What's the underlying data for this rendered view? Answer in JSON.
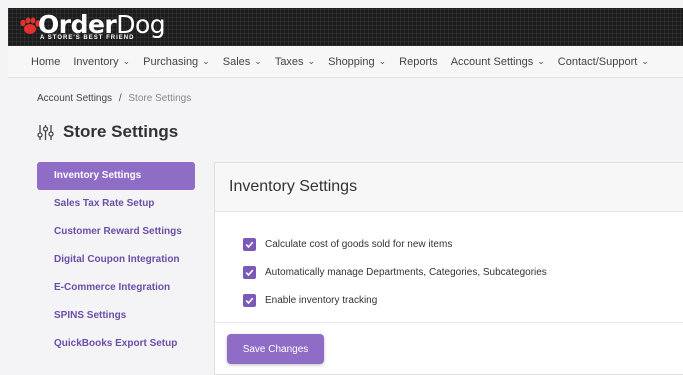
{
  "logo": {
    "name_bold": "Order",
    "name_light": "Dog",
    "tagline": "A STORE'S BEST FRIEND",
    "icon": "paw-icon",
    "accent": "#e3322b"
  },
  "nav": {
    "items": [
      {
        "label": "Home",
        "dropdown": false
      },
      {
        "label": "Inventory",
        "dropdown": true
      },
      {
        "label": "Purchasing",
        "dropdown": true
      },
      {
        "label": "Sales",
        "dropdown": true
      },
      {
        "label": "Taxes",
        "dropdown": true
      },
      {
        "label": "Shopping",
        "dropdown": true
      },
      {
        "label": "Reports",
        "dropdown": false
      },
      {
        "label": "Account Settings",
        "dropdown": true
      },
      {
        "label": "Contact/Support",
        "dropdown": true
      }
    ],
    "chevron": "⌄"
  },
  "breadcrumb": {
    "parent": "Account Settings",
    "separator": "/",
    "current": "Store Settings"
  },
  "page": {
    "title": "Store Settings",
    "icon": "sliders-icon"
  },
  "sidebar": {
    "items": [
      {
        "label": "Inventory Settings",
        "active": true
      },
      {
        "label": "Sales Tax Rate Setup",
        "active": false
      },
      {
        "label": "Customer Reward Settings",
        "active": false
      },
      {
        "label": "Digital Coupon Integration",
        "active": false
      },
      {
        "label": "E-Commerce Integration",
        "active": false
      },
      {
        "label": "SPINS Settings",
        "active": false
      },
      {
        "label": "QuickBooks Export Setup",
        "active": false
      }
    ]
  },
  "panel": {
    "title": "Inventory Settings",
    "options": [
      {
        "label": "Calculate cost of goods sold for new items",
        "checked": true
      },
      {
        "label": "Automatically manage Departments, Categories, Subcategories",
        "checked": true
      },
      {
        "label": "Enable inventory tracking",
        "checked": true
      }
    ],
    "save_label": "Save Changes"
  },
  "colors": {
    "brand_purple": "#8f6cc6",
    "link_purple": "#6a4fa6",
    "checkbox": "#7b59b8"
  }
}
